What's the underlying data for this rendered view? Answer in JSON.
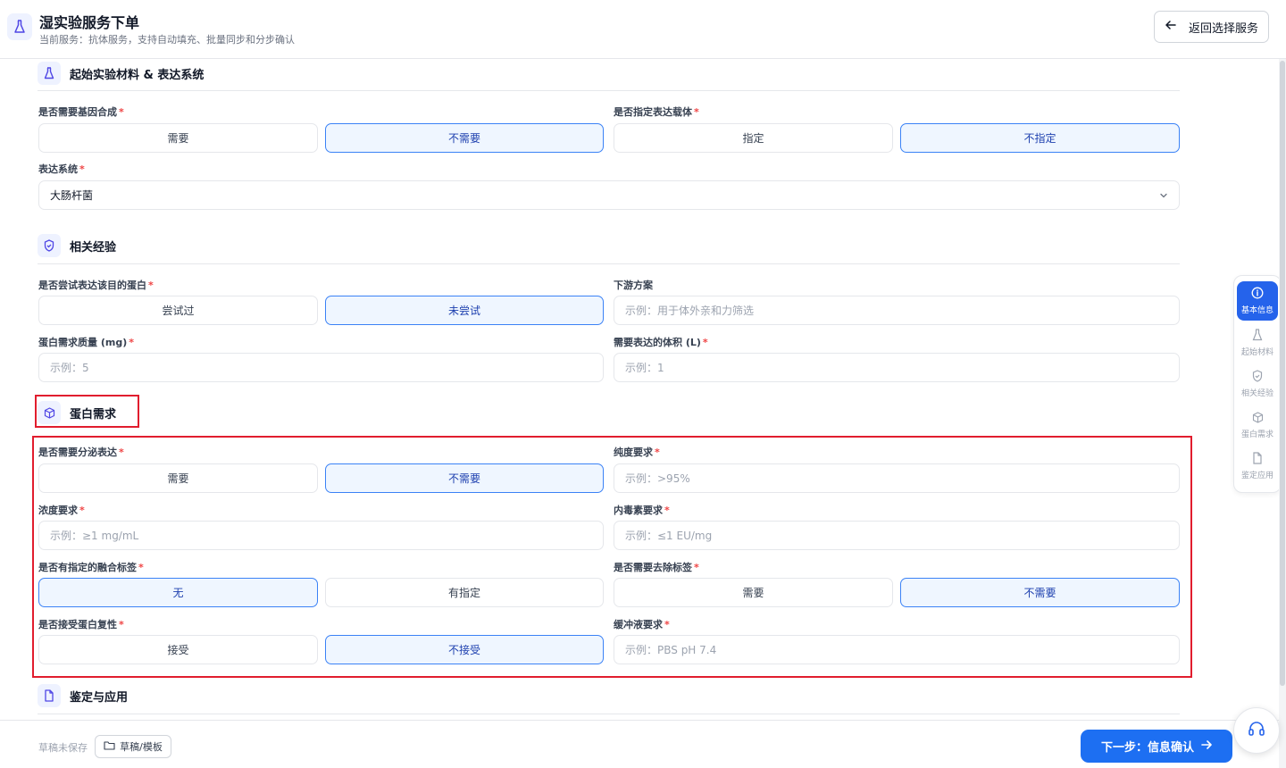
{
  "header": {
    "title": "湿实验服务下单",
    "subtitle": "当前服务：抗体服务，支持自动填充、批量同步和分步确认",
    "back_label": "返回选择服务"
  },
  "sections": {
    "materials": {
      "title": "起始实验材料 & 表达系统",
      "gene_synthesis": {
        "label": "是否需要基因合成",
        "options": [
          "需要",
          "不需要"
        ],
        "selected": "不需要"
      },
      "vector": {
        "label": "是否指定表达载体",
        "options": [
          "指定",
          "不指定"
        ],
        "selected": "不指定"
      },
      "expression_system": {
        "label": "表达系统",
        "value": "大肠杆菌"
      }
    },
    "experience": {
      "title": "相关经验",
      "tried": {
        "label": "是否尝试表达该目的蛋白",
        "options": [
          "尝试过",
          "未尝试"
        ],
        "selected": "未尝试"
      },
      "downstream": {
        "label": "下游方案",
        "placeholder": "示例：用于体外亲和力筛选"
      },
      "mass": {
        "label": "蛋白需求质量 (mg)",
        "placeholder": "示例：5"
      },
      "volume": {
        "label": "需要表达的体积 (L)",
        "placeholder": "示例：1"
      }
    },
    "protein": {
      "title": "蛋白需求",
      "secretion": {
        "label": "是否需要分泌表达",
        "options": [
          "需要",
          "不需要"
        ],
        "selected": "不需要"
      },
      "purity": {
        "label": "纯度要求",
        "placeholder": "示例：>95%"
      },
      "concentration": {
        "label": "浓度要求",
        "placeholder": "示例：≥1 mg/mL"
      },
      "endotoxin": {
        "label": "内毒素要求",
        "placeholder": "示例：≤1 EU/mg"
      },
      "fusion_tag": {
        "label": "是否有指定的融合标签",
        "options": [
          "无",
          "有指定"
        ],
        "selected": "无"
      },
      "tag_removal": {
        "label": "是否需要去除标签",
        "options": [
          "需要",
          "不需要"
        ],
        "selected": "不需要"
      },
      "refolding": {
        "label": "是否接受蛋白复性",
        "options": [
          "接受",
          "不接受"
        ],
        "selected": "不接受"
      },
      "buffer": {
        "label": "缓冲液要求",
        "placeholder": "示例：PBS pH 7.4"
      }
    },
    "identification": {
      "title": "鉴定与应用"
    }
  },
  "required_mark": "*",
  "side_nav": {
    "items": [
      {
        "label": "基本信息",
        "icon": "info-icon",
        "active": true
      },
      {
        "label": "起始材料",
        "icon": "flask-icon",
        "active": false
      },
      {
        "label": "相关经验",
        "icon": "shield-icon",
        "active": false
      },
      {
        "label": "蛋白需求",
        "icon": "cube-icon",
        "active": false
      },
      {
        "label": "鉴定应用",
        "icon": "document-icon",
        "active": false
      }
    ]
  },
  "footer": {
    "draft_status": "草稿未保存",
    "draft_button": "草稿/模板",
    "next_button": "下一步：信息确认"
  },
  "colors": {
    "accent": "#1d6ff2",
    "selected_border": "#3b82f6",
    "selected_bg": "#eff6ff",
    "highlight": "#e11d2e",
    "required": "#ef4444"
  }
}
